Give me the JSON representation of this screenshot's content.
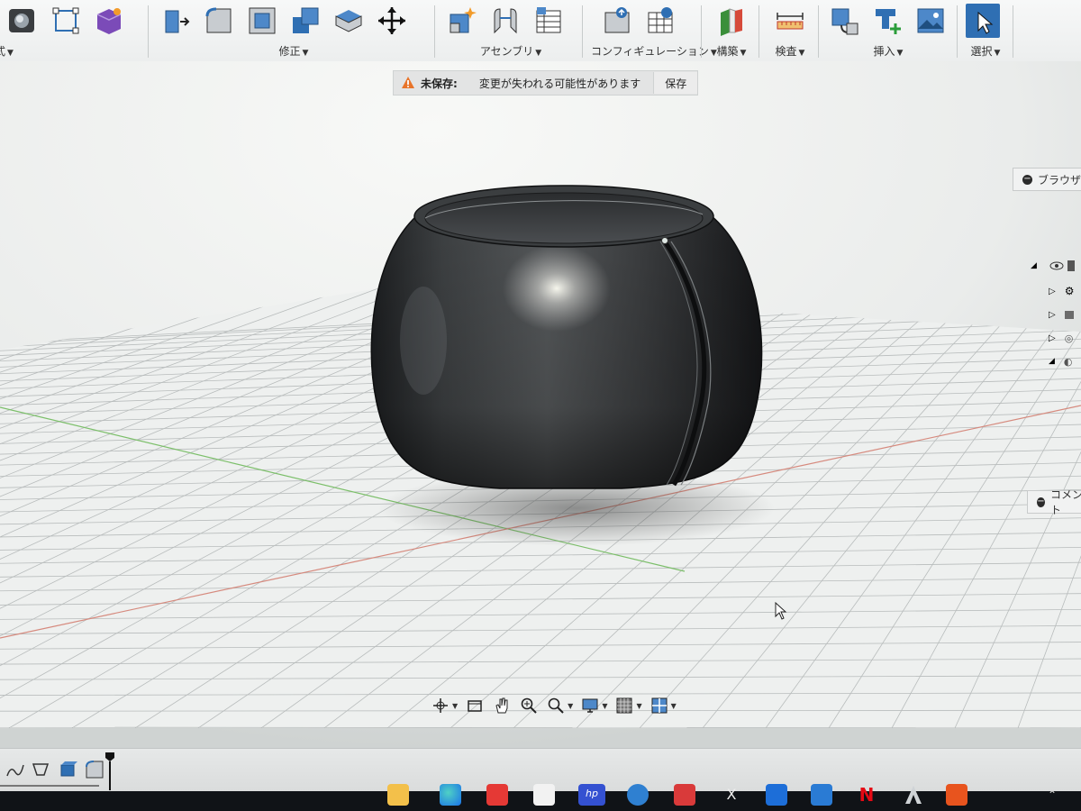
{
  "toolbar": {
    "groups": [
      {
        "label": "式",
        "icons": [
          "solid-body-icon",
          "sketch-rectangle-icon",
          "form-icon"
        ]
      },
      {
        "label": "修正",
        "icons": [
          "press-pull-icon",
          "fillet-icon",
          "shell-icon",
          "combine-icon",
          "replace-face-icon",
          "move-icon"
        ]
      },
      {
        "label": "アセンブリ",
        "icons": [
          "new-component-icon",
          "joint-icon",
          "bom-table-icon"
        ]
      },
      {
        "label": "コンフィギュレーション",
        "icons": [
          "configure-icon",
          "configuration-table-icon"
        ]
      },
      {
        "label": "構築",
        "icons": [
          "construct-plane-icon"
        ]
      },
      {
        "label": "検査",
        "icons": [
          "measure-icon"
        ]
      },
      {
        "label": "挿入",
        "icons": [
          "insert-derive-icon",
          "insert-mesh-icon",
          "insert-image-icon"
        ]
      },
      {
        "label": "選択",
        "icons": [
          "select-arrow-icon"
        ]
      }
    ]
  },
  "unsaved_bar": {
    "status": "未保存:",
    "message": "変更が失われる可能性があります",
    "save_label": "保存"
  },
  "right_panels": {
    "browser_label": "ブラウザ",
    "comments_label": "コメント"
  },
  "nav_bar": {
    "icons": [
      "orbit-icon",
      "look-at-icon",
      "pan-icon",
      "zoom-icon",
      "fit-icon",
      "display-settings-icon",
      "grid-settings-icon",
      "viewports-icon"
    ]
  },
  "timeline": {
    "items": [
      "sketch-feature-icon",
      "sketch-profile-icon",
      "extrude-feature-icon",
      "fillet-feature-icon"
    ]
  },
  "taskbar": {
    "apps": [
      "file-explorer-icon",
      "edge-browser-icon",
      "youtube-icon",
      "store-icon",
      "hp-icon",
      "help-icon",
      "app-red-icon",
      "x-icon",
      "dropbox-icon",
      "stack-icon",
      "netflix-icon",
      "autodesk-icon",
      "fusion-icon",
      "tray-chevron-icon"
    ],
    "x_label": "X",
    "hp_label": "hp",
    "netflix_label": "N"
  }
}
